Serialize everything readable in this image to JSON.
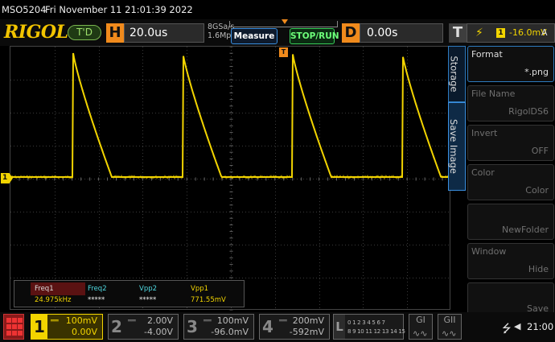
{
  "header": {
    "model": "MSO5204",
    "datetime": "Fri November 11 21:01:39 2022"
  },
  "toolbar": {
    "logo": "RIGOL",
    "trig_status": "T'D",
    "horizontal_letter": "H",
    "timebase": "20.0us",
    "sample_rate": "8GSa/s",
    "memory_depth": "1.6Mpts",
    "measure_label": "Measure",
    "stop_run_label": "STOP/RUN",
    "delay_letter": "D",
    "delay": "0.00s",
    "trigger_letter": "T",
    "trigger_source": "1",
    "trigger_level": "-16.0mV",
    "trigger_mode": "A"
  },
  "markers": {
    "ch1": "1",
    "trigger": "T"
  },
  "measurements": [
    {
      "name": "Freq1",
      "value": "24.975kHz",
      "color": "#f2d400",
      "selected": true
    },
    {
      "name": "Freq2",
      "value": "*****",
      "color": "#4fd8e0",
      "selected": false
    },
    {
      "name": "Vpp2",
      "value": "*****",
      "color": "#4fd8e0",
      "selected": false
    },
    {
      "name": "Vpp1",
      "value": "771.55mV",
      "color": "#f2d400",
      "selected": false
    }
  ],
  "menu": {
    "tabs": [
      "Storage",
      "Save Image"
    ],
    "items": [
      {
        "label": "Format",
        "value": "*.png",
        "state": "active"
      },
      {
        "label": "File Name",
        "value": "RigolDS6",
        "state": "dim"
      },
      {
        "label": "Invert",
        "value": "OFF",
        "state": "dim"
      },
      {
        "label": "Color",
        "value": "Color",
        "state": "dim"
      },
      {
        "label": "",
        "value": "NewFolder",
        "state": "dim"
      },
      {
        "label": "Window",
        "value": "Hide",
        "state": "dim"
      },
      {
        "label": "",
        "value": "Save",
        "state": "dim"
      }
    ]
  },
  "channels": [
    {
      "num": "1",
      "scale": "100mV",
      "offset": "0.00V",
      "on": true
    },
    {
      "num": "2",
      "scale": "2.00V",
      "offset": "-4.00V",
      "on": false
    },
    {
      "num": "3",
      "scale": "100mV",
      "offset": "-96.0mV",
      "on": false
    },
    {
      "num": "4",
      "scale": "200mV",
      "offset": "-592mV",
      "on": false
    }
  ],
  "logic": {
    "letter": "L",
    "row1": "0 1 2 3 4 5 6 7",
    "row2": "8 9 10 11 12 13 14 15"
  },
  "generators": [
    "GI",
    "GII"
  ],
  "status": {
    "time": "21:00"
  },
  "colors": {
    "ch1": "#f2d400",
    "accent_orange": "#f08a1c",
    "menu_blue": "#2e7bbf",
    "measure_cyan": "#4fd8e0"
  }
}
